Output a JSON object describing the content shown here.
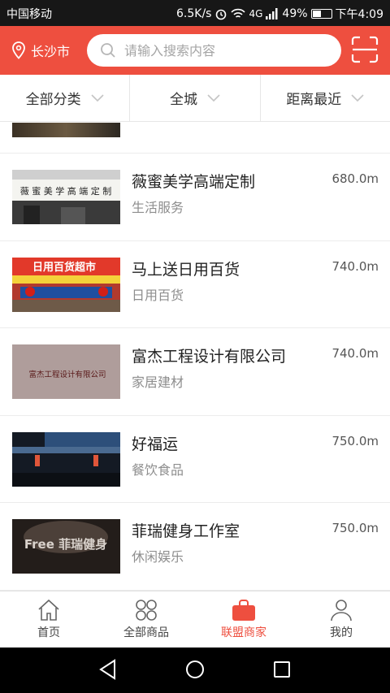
{
  "status_bar": {
    "carrier": "中国移动",
    "speed": "6.5K/s",
    "network": "4G",
    "battery": "49%",
    "time": "下午4:09"
  },
  "header": {
    "city": "长沙市",
    "search_placeholder": "请输入搜索内容"
  },
  "filters": [
    {
      "label": "全部分类"
    },
    {
      "label": "全城"
    },
    {
      "label": "距离最近"
    }
  ],
  "merchants": [
    {
      "name": "薇蜜美学高端定制",
      "category": "生活服务",
      "distance": "680.0m",
      "thumb_text": "薇 蜜 美 学 高 端 定 制"
    },
    {
      "name": "马上送日用百货",
      "category": "日用百货",
      "distance": "740.0m",
      "thumb_text": "日用百货超市"
    },
    {
      "name": "富杰工程设计有限公司",
      "category": "家居建材",
      "distance": "740.0m",
      "thumb_text": "富杰工程设计有限公司"
    },
    {
      "name": "好福运",
      "category": "餐饮食品",
      "distance": "750.0m",
      "thumb_text": ""
    },
    {
      "name": "菲瑞健身工作室",
      "category": "休闲娱乐",
      "distance": "750.0m",
      "thumb_text": "Free 菲瑞健身"
    }
  ],
  "tabs": [
    {
      "label": "首页",
      "icon": "home-icon"
    },
    {
      "label": "全部商品",
      "icon": "grid-icon"
    },
    {
      "label": "联盟商家",
      "icon": "shopping-bag-icon"
    },
    {
      "label": "我的",
      "icon": "user-icon"
    }
  ],
  "colors": {
    "accent": "#ee4f3f"
  }
}
